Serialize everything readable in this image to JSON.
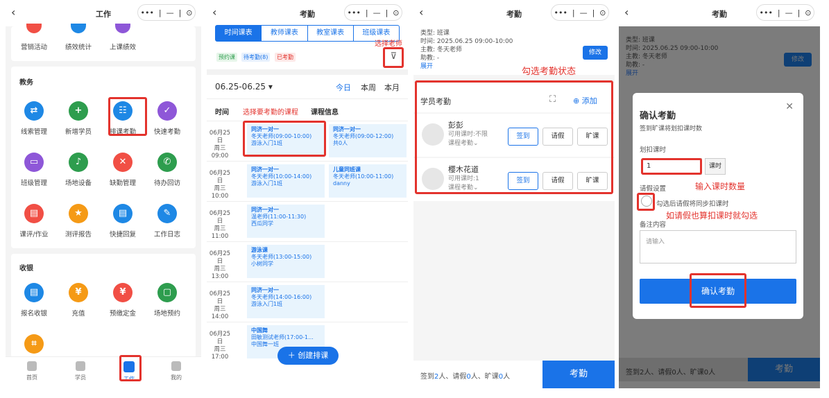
{
  "p1": {
    "title": "工作",
    "top_labels": [
      "营销活动",
      "绩效统计",
      "上课绩效"
    ],
    "jw_title": "教务",
    "jw_items": [
      {
        "label": "线索管理",
        "icon": "exchange-icon",
        "color": "#1e88e5",
        "g": "⇄"
      },
      {
        "label": "新增学员",
        "icon": "add-user-icon",
        "color": "#2e9d4e",
        "g": "+"
      },
      {
        "label": "排课考勤",
        "icon": "schedule-icon",
        "color": "#1e88e5",
        "g": "☷"
      },
      {
        "label": "快速考勤",
        "icon": "check-icon",
        "color": "#8e57d8",
        "g": "✓"
      },
      {
        "label": "班级管理",
        "icon": "class-icon",
        "color": "#8e57d8",
        "g": "▭"
      },
      {
        "label": "场地设备",
        "icon": "bell-icon",
        "color": "#2e9d4e",
        "g": "♪"
      },
      {
        "label": "缺勤管理",
        "icon": "absence-icon",
        "color": "#f14f45",
        "g": "✕"
      },
      {
        "label": "待办回访",
        "icon": "phone-icon",
        "color": "#2e9d4e",
        "g": "✆"
      },
      {
        "label": "课评/作业",
        "icon": "homework-icon",
        "color": "#f14f45",
        "g": "▤"
      },
      {
        "label": "测评报告",
        "icon": "report-icon",
        "color": "#f59a16",
        "g": "★"
      },
      {
        "label": "快捷回复",
        "icon": "reply-icon",
        "color": "#1e88e5",
        "g": "▤"
      },
      {
        "label": "工作日志",
        "icon": "edit-icon",
        "color": "#1e88e5",
        "g": "✎"
      }
    ],
    "sy_title": "收银",
    "sy_items": [
      {
        "label": "报名收银",
        "icon": "register-icon",
        "color": "#1e88e5",
        "g": "▤"
      },
      {
        "label": "充值",
        "icon": "recharge-icon",
        "color": "#f59a16",
        "g": "¥"
      },
      {
        "label": "预缴定金",
        "icon": "deposit-icon",
        "color": "#f14f45",
        "g": "¥"
      },
      {
        "label": "场地预约",
        "icon": "calendar-icon",
        "color": "#2e9d4e",
        "g": "▢"
      },
      {
        "label": "",
        "icon": "scan-icon",
        "color": "#f59a16",
        "g": "⌗"
      }
    ],
    "nav": [
      "首页",
      "学员",
      "工作",
      "我的"
    ]
  },
  "p2": {
    "title": "考勤",
    "tabs": [
      "时间课表",
      "教师课表",
      "教室课表",
      "班级课表"
    ],
    "filter_note": "选择老师",
    "tags": [
      {
        "t": "预约课",
        "c": "#2e9d4e",
        "bg": "#e7f6ea"
      },
      {
        "t": "待考勤(8)",
        "c": "#1a73e8",
        "bg": "#e8f1fd"
      },
      {
        "t": "已考勤",
        "c": "#e3332d",
        "bg": "#fde9e8"
      }
    ],
    "date_range": "06.25-06.25 ▾",
    "today": "今日",
    "week": "本周",
    "month": "本月",
    "col_time": "时间",
    "col_info": "课程信息",
    "pick_note": "选择要考勤的课程",
    "rows": [
      {
        "time": [
          "06月25日",
          "周三",
          "09:00"
        ],
        "cards": [
          [
            "同济一对一",
            "冬天老师(09:00-10:00)",
            "游泳入门1班"
          ],
          [
            "同济一对一",
            "冬天老师(09:00-12:00)",
            "共0人"
          ]
        ]
      },
      {
        "time": [
          "06月25日",
          "周三",
          "10:00"
        ],
        "cards": [
          [
            "同济一对一",
            "冬天老师(10:00-14:00)",
            "游泳入门1班"
          ],
          [
            "儿童同班课",
            "冬天老师(10:00-11:00)",
            "danny"
          ]
        ]
      },
      {
        "time": [
          "06月25日",
          "周三",
          "11:00"
        ],
        "cards": [
          [
            "同济一对一",
            "温老师(11:00-11:30)",
            "西瓜同学"
          ]
        ]
      },
      {
        "time": [
          "06月25日",
          "周三",
          "13:00"
        ],
        "cards": [
          [
            "游泳课",
            "冬天老师(13:00-15:00)",
            "小树同学"
          ]
        ]
      },
      {
        "time": [
          "06月25日",
          "周三",
          "14:00"
        ],
        "cards": [
          [
            "同济一对一",
            "冬天老师(14:00-16:00)",
            "游泳入门1班"
          ]
        ]
      },
      {
        "time": [
          "06月25日",
          "周三",
          "17:00"
        ],
        "cards": [
          [
            "中国舞",
            "田敏测试老师(17:00-1...",
            "中国舞一班"
          ]
        ]
      }
    ],
    "create": "＋ 创建排课"
  },
  "p3": {
    "title": "考勤",
    "info": [
      "类型: 班课",
      "时间: 2025.06.25 09:00-10:00",
      "主教: 冬天老师",
      "助教: -"
    ],
    "expand": "展开",
    "edit": "修改",
    "note": "勾选考勤状态",
    "section": "学员考勤",
    "add": "⊕ 添加",
    "students": [
      {
        "name": "彭彭",
        "sub1": "可用课时:不限",
        "sub2": "课程考勤⌄"
      },
      {
        "name": "樱木花道",
        "sub1": "可用课时:1",
        "sub2": "课程考勤⌄"
      }
    ],
    "btns": [
      "签到",
      "请假",
      "旷课"
    ],
    "summary_a": "签到",
    "summary_a_n": "2",
    "summary_b": "人、请假",
    "summary_b_n": "0",
    "summary_c": "人、旷课",
    "summary_c_n": "0",
    "summary_d": "人",
    "submit": "考勤"
  },
  "p4": {
    "title": "考勤",
    "info": [
      "类型: 班课",
      "时间: 2025.06.25 09:00-10:00",
      "主教: 冬天老师",
      "助教: -"
    ],
    "expand": "展开",
    "edit": "修改",
    "dlg_title": "确认考勤",
    "dlg_sub": "签到旷课将划扣课时数",
    "deduct_label": "划扣课时",
    "deduct_value": "1",
    "unit": "课时",
    "note1": "输入课时数量",
    "leave_label": "请假设置",
    "leave_check": "勾选后请假将同步扣课时",
    "note2": "如请假也算扣课时就勾选",
    "remark_label": "备注内容",
    "remark_ph": "请输入",
    "confirm": "确认考勤",
    "summary": "签到2人、请假0人、旷课0人",
    "submit": "考勤"
  }
}
